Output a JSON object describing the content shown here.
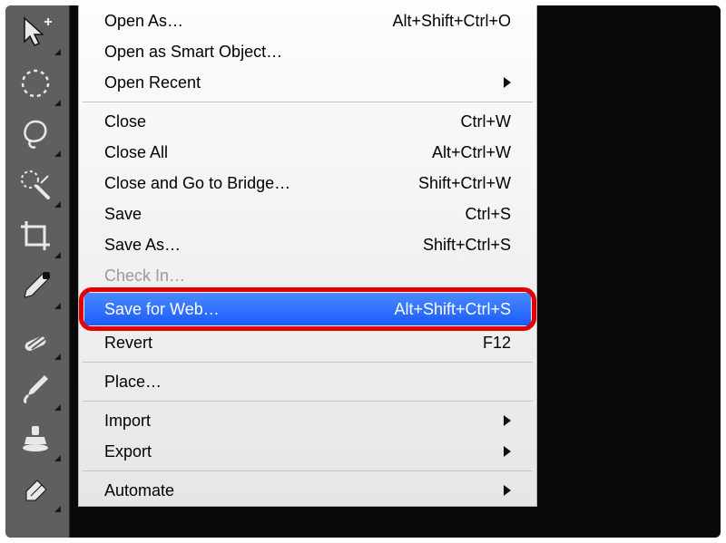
{
  "tools": [
    {
      "id": "move",
      "name": "move-tool-icon"
    },
    {
      "id": "marquee",
      "name": "marquee-tool-icon"
    },
    {
      "id": "lasso",
      "name": "lasso-tool-icon"
    },
    {
      "id": "quickselect",
      "name": "quick-selection-tool-icon"
    },
    {
      "id": "crop",
      "name": "crop-tool-icon"
    },
    {
      "id": "eyedropper",
      "name": "eyedropper-tool-icon"
    },
    {
      "id": "healing",
      "name": "healing-brush-tool-icon"
    },
    {
      "id": "brush",
      "name": "brush-tool-icon"
    },
    {
      "id": "stamp",
      "name": "clone-stamp-tool-icon"
    },
    {
      "id": "eraser",
      "name": "eraser-tool-icon"
    }
  ],
  "menu": {
    "open_as": {
      "label": "Open As…",
      "accel": "Alt+Shift+Ctrl+O"
    },
    "open_smart": {
      "label": "Open as Smart Object…"
    },
    "open_recent": {
      "label": "Open Recent",
      "submenu": true
    },
    "close": {
      "label": "Close",
      "accel": "Ctrl+W"
    },
    "close_all": {
      "label": "Close All",
      "accel": "Alt+Ctrl+W"
    },
    "close_bridge": {
      "label": "Close and Go to Bridge…",
      "accel": "Shift+Ctrl+W"
    },
    "save": {
      "label": "Save",
      "accel": "Ctrl+S"
    },
    "save_as": {
      "label": "Save As…",
      "accel": "Shift+Ctrl+S"
    },
    "check_in": {
      "label": "Check In…",
      "disabled": true
    },
    "save_for_web": {
      "label": "Save for Web…",
      "accel": "Alt+Shift+Ctrl+S",
      "highlighted": true
    },
    "revert": {
      "label": "Revert",
      "accel": "F12"
    },
    "place": {
      "label": "Place…"
    },
    "import": {
      "label": "Import",
      "submenu": true
    },
    "export": {
      "label": "Export",
      "submenu": true
    },
    "automate": {
      "label": "Automate",
      "submenu": true
    }
  }
}
